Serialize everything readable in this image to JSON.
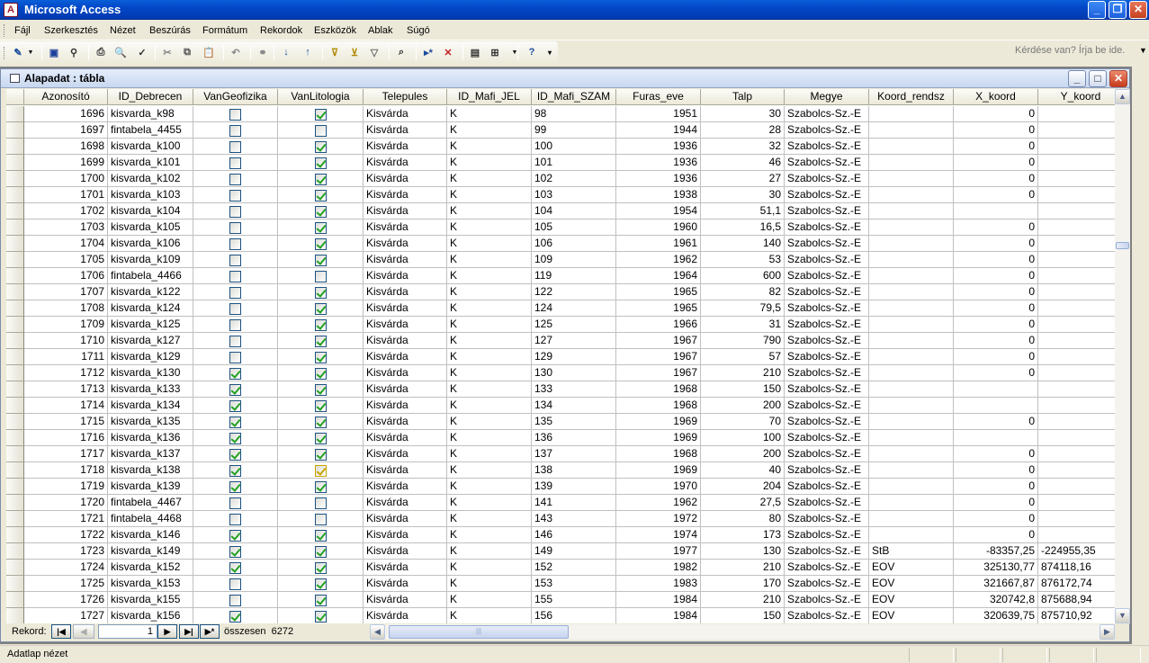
{
  "app": {
    "title": "Microsoft Access"
  },
  "menu": {
    "items": [
      "Fájl",
      "Szerkesztés",
      "Nézet",
      "Beszúrás",
      "Formátum",
      "Rekordok",
      "Eszközök",
      "Ablak",
      "Súgó"
    ],
    "help_placeholder": "Kérdése van? Írja be ide."
  },
  "toolbar": {
    "icons": [
      "view-icon",
      "save-icon",
      "search-icon",
      "print-icon",
      "print-preview-icon",
      "spelling-icon",
      "cut-icon",
      "copy-icon",
      "paste-icon",
      "undo-icon",
      "hyperlink-icon",
      "sort-ascending-icon",
      "sort-descending-icon",
      "filter-by-selection-icon",
      "filter-by-form-icon",
      "apply-filter-icon",
      "find-icon",
      "new-record-icon",
      "delete-record-icon",
      "database-window-icon",
      "new-object-icon",
      "help-icon"
    ]
  },
  "document": {
    "title": "Alapadat : tábla"
  },
  "table": {
    "columns": [
      "Azonosító",
      "ID_Debrecen",
      "VanGeofizika",
      "VanLitologia",
      "Telepules",
      "ID_Mafi_JEL",
      "ID_Mafi_SZAM",
      "Furas_eve",
      "Talp",
      "Megye",
      "Koord_rendsz",
      "X_koord",
      "Y_koord"
    ],
    "rows": [
      {
        "id": "1696",
        "id_debrecen": "kisvarda_k98",
        "geo": false,
        "lito": true,
        "telepules": "Kisvárda",
        "jel": "K",
        "szam": "98",
        "ev": "1951",
        "talp": "30",
        "megye": "Szabolcs-Sz.-E",
        "koord": "",
        "x": "0",
        "y": ""
      },
      {
        "id": "1697",
        "id_debrecen": "fintabela_4455",
        "geo": false,
        "lito": false,
        "telepules": "Kisvárda",
        "jel": "K",
        "szam": "99",
        "ev": "1944",
        "talp": "28",
        "megye": "Szabolcs-Sz.-E",
        "koord": "",
        "x": "0",
        "y": ""
      },
      {
        "id": "1698",
        "id_debrecen": "kisvarda_k100",
        "geo": false,
        "lito": true,
        "telepules": "Kisvárda",
        "jel": "K",
        "szam": "100",
        "ev": "1936",
        "talp": "32",
        "megye": "Szabolcs-Sz.-E",
        "koord": "",
        "x": "0",
        "y": ""
      },
      {
        "id": "1699",
        "id_debrecen": "kisvarda_k101",
        "geo": false,
        "lito": true,
        "telepules": "Kisvárda",
        "jel": "K",
        "szam": "101",
        "ev": "1936",
        "talp": "46",
        "megye": "Szabolcs-Sz.-E",
        "koord": "",
        "x": "0",
        "y": ""
      },
      {
        "id": "1700",
        "id_debrecen": "kisvarda_k102",
        "geo": false,
        "lito": true,
        "telepules": "Kisvárda",
        "jel": "K",
        "szam": "102",
        "ev": "1936",
        "talp": "27",
        "megye": "Szabolcs-Sz.-E",
        "koord": "",
        "x": "0",
        "y": ""
      },
      {
        "id": "1701",
        "id_debrecen": "kisvarda_k103",
        "geo": false,
        "lito": true,
        "telepules": "Kisvárda",
        "jel": "K",
        "szam": "103",
        "ev": "1938",
        "talp": "30",
        "megye": "Szabolcs-Sz.-E",
        "koord": "",
        "x": "0",
        "y": ""
      },
      {
        "id": "1702",
        "id_debrecen": "kisvarda_k104",
        "geo": false,
        "lito": true,
        "telepules": "Kisvárda",
        "jel": "K",
        "szam": "104",
        "ev": "1954",
        "talp": "51,1",
        "megye": "Szabolcs-Sz.-E",
        "koord": "",
        "x": "",
        "y": ""
      },
      {
        "id": "1703",
        "id_debrecen": "kisvarda_k105",
        "geo": false,
        "lito": true,
        "telepules": "Kisvárda",
        "jel": "K",
        "szam": "105",
        "ev": "1960",
        "talp": "16,5",
        "megye": "Szabolcs-Sz.-E",
        "koord": "",
        "x": "0",
        "y": ""
      },
      {
        "id": "1704",
        "id_debrecen": "kisvarda_k106",
        "geo": false,
        "lito": true,
        "telepules": "Kisvárda",
        "jel": "K",
        "szam": "106",
        "ev": "1961",
        "talp": "140",
        "megye": "Szabolcs-Sz.-E",
        "koord": "",
        "x": "0",
        "y": ""
      },
      {
        "id": "1705",
        "id_debrecen": "kisvarda_k109",
        "geo": false,
        "lito": true,
        "telepules": "Kisvárda",
        "jel": "K",
        "szam": "109",
        "ev": "1962",
        "talp": "53",
        "megye": "Szabolcs-Sz.-E",
        "koord": "",
        "x": "0",
        "y": ""
      },
      {
        "id": "1706",
        "id_debrecen": "fintabela_4466",
        "geo": false,
        "lito": false,
        "telepules": "Kisvárda",
        "jel": "K",
        "szam": "119",
        "ev": "1964",
        "talp": "600",
        "megye": "Szabolcs-Sz.-E",
        "koord": "",
        "x": "0",
        "y": ""
      },
      {
        "id": "1707",
        "id_debrecen": "kisvarda_k122",
        "geo": false,
        "lito": true,
        "telepules": "Kisvárda",
        "jel": "K",
        "szam": "122",
        "ev": "1965",
        "talp": "82",
        "megye": "Szabolcs-Sz.-E",
        "koord": "",
        "x": "0",
        "y": ""
      },
      {
        "id": "1708",
        "id_debrecen": "kisvarda_k124",
        "geo": false,
        "lito": true,
        "telepules": "Kisvárda",
        "jel": "K",
        "szam": "124",
        "ev": "1965",
        "talp": "79,5",
        "megye": "Szabolcs-Sz.-E",
        "koord": "",
        "x": "0",
        "y": ""
      },
      {
        "id": "1709",
        "id_debrecen": "kisvarda_k125",
        "geo": false,
        "lito": true,
        "telepules": "Kisvárda",
        "jel": "K",
        "szam": "125",
        "ev": "1966",
        "talp": "31",
        "megye": "Szabolcs-Sz.-E",
        "koord": "",
        "x": "0",
        "y": ""
      },
      {
        "id": "1710",
        "id_debrecen": "kisvarda_k127",
        "geo": false,
        "lito": true,
        "telepules": "Kisvárda",
        "jel": "K",
        "szam": "127",
        "ev": "1967",
        "talp": "790",
        "megye": "Szabolcs-Sz.-E",
        "koord": "",
        "x": "0",
        "y": ""
      },
      {
        "id": "1711",
        "id_debrecen": "kisvarda_k129",
        "geo": false,
        "lito": true,
        "telepules": "Kisvárda",
        "jel": "K",
        "szam": "129",
        "ev": "1967",
        "talp": "57",
        "megye": "Szabolcs-Sz.-E",
        "koord": "",
        "x": "0",
        "y": ""
      },
      {
        "id": "1712",
        "id_debrecen": "kisvarda_k130",
        "geo": true,
        "lito": true,
        "telepules": "Kisvárda",
        "jel": "K",
        "szam": "130",
        "ev": "1967",
        "talp": "210",
        "megye": "Szabolcs-Sz.-E",
        "koord": "",
        "x": "0",
        "y": ""
      },
      {
        "id": "1713",
        "id_debrecen": "kisvarda_k133",
        "geo": true,
        "lito": true,
        "telepules": "Kisvárda",
        "jel": "K",
        "szam": "133",
        "ev": "1968",
        "talp": "150",
        "megye": "Szabolcs-Sz.-E",
        "koord": "",
        "x": "",
        "y": ""
      },
      {
        "id": "1714",
        "id_debrecen": "kisvarda_k134",
        "geo": true,
        "lito": true,
        "telepules": "Kisvárda",
        "jel": "K",
        "szam": "134",
        "ev": "1968",
        "talp": "200",
        "megye": "Szabolcs-Sz.-E",
        "koord": "",
        "x": "",
        "y": ""
      },
      {
        "id": "1715",
        "id_debrecen": "kisvarda_k135",
        "geo": true,
        "lito": true,
        "telepules": "Kisvárda",
        "jel": "K",
        "szam": "135",
        "ev": "1969",
        "talp": "70",
        "megye": "Szabolcs-Sz.-E",
        "koord": "",
        "x": "0",
        "y": ""
      },
      {
        "id": "1716",
        "id_debrecen": "kisvarda_k136",
        "geo": true,
        "lito": true,
        "telepules": "Kisvárda",
        "jel": "K",
        "szam": "136",
        "ev": "1969",
        "talp": "100",
        "megye": "Szabolcs-Sz.-E",
        "koord": "",
        "x": "",
        "y": ""
      },
      {
        "id": "1717",
        "id_debrecen": "kisvarda_k137",
        "geo": true,
        "lito": true,
        "telepules": "Kisvárda",
        "jel": "K",
        "szam": "137",
        "ev": "1968",
        "talp": "200",
        "megye": "Szabolcs-Sz.-E",
        "koord": "",
        "x": "0",
        "y": ""
      },
      {
        "id": "1718",
        "id_debrecen": "kisvarda_k138",
        "geo": true,
        "lito": true,
        "lito_highlight": true,
        "telepules": "Kisvárda",
        "jel": "K",
        "szam": "138",
        "ev": "1969",
        "talp": "40",
        "megye": "Szabolcs-Sz.-E",
        "koord": "",
        "x": "0",
        "y": ""
      },
      {
        "id": "1719",
        "id_debrecen": "kisvarda_k139",
        "geo": true,
        "lito": true,
        "telepules": "Kisvárda",
        "jel": "K",
        "szam": "139",
        "ev": "1970",
        "talp": "204",
        "megye": "Szabolcs-Sz.-E",
        "koord": "",
        "x": "0",
        "y": ""
      },
      {
        "id": "1720",
        "id_debrecen": "fintabela_4467",
        "geo": false,
        "lito": false,
        "telepules": "Kisvárda",
        "jel": "K",
        "szam": "141",
        "ev": "1962",
        "talp": "27,5",
        "megye": "Szabolcs-Sz.-E",
        "koord": "",
        "x": "0",
        "y": ""
      },
      {
        "id": "1721",
        "id_debrecen": "fintabela_4468",
        "geo": false,
        "lito": false,
        "telepules": "Kisvárda",
        "jel": "K",
        "szam": "143",
        "ev": "1972",
        "talp": "80",
        "megye": "Szabolcs-Sz.-E",
        "koord": "",
        "x": "0",
        "y": ""
      },
      {
        "id": "1722",
        "id_debrecen": "kisvarda_k146",
        "geo": true,
        "lito": true,
        "telepules": "Kisvárda",
        "jel": "K",
        "szam": "146",
        "ev": "1974",
        "talp": "173",
        "megye": "Szabolcs-Sz.-E",
        "koord": "",
        "x": "0",
        "y": ""
      },
      {
        "id": "1723",
        "id_debrecen": "kisvarda_k149",
        "geo": true,
        "lito": true,
        "telepules": "Kisvárda",
        "jel": "K",
        "szam": "149",
        "ev": "1977",
        "talp": "130",
        "megye": "Szabolcs-Sz.-E",
        "koord": "StB",
        "x": "-83357,25",
        "y": "-224955,35"
      },
      {
        "id": "1724",
        "id_debrecen": "kisvarda_k152",
        "geo": true,
        "lito": true,
        "telepules": "Kisvárda",
        "jel": "K",
        "szam": "152",
        "ev": "1982",
        "talp": "210",
        "megye": "Szabolcs-Sz.-E",
        "koord": "EOV",
        "x": "325130,77",
        "y": "874118,16"
      },
      {
        "id": "1725",
        "id_debrecen": "kisvarda_k153",
        "geo": false,
        "lito": true,
        "telepules": "Kisvárda",
        "jel": "K",
        "szam": "153",
        "ev": "1983",
        "talp": "170",
        "megye": "Szabolcs-Sz.-E",
        "koord": "EOV",
        "x": "321667,87",
        "y": "876172,74"
      },
      {
        "id": "1726",
        "id_debrecen": "kisvarda_k155",
        "geo": false,
        "lito": true,
        "telepules": "Kisvárda",
        "jel": "K",
        "szam": "155",
        "ev": "1984",
        "talp": "210",
        "megye": "Szabolcs-Sz.-E",
        "koord": "EOV",
        "x": "320742,8",
        "y": "875688,94"
      },
      {
        "id": "1727",
        "id_debrecen": "kisvarda_k156",
        "geo": true,
        "lito": true,
        "telepules": "Kisvárda",
        "jel": "K",
        "szam": "156",
        "ev": "1984",
        "talp": "150",
        "megye": "Szabolcs-Sz.-E",
        "koord": "EOV",
        "x": "320639,75",
        "y": "875710,92"
      }
    ]
  },
  "navigation": {
    "label": "Rekord:",
    "current": "1",
    "total_label": "összesen",
    "total": "6272"
  },
  "status": {
    "text": "Adatlap nézet"
  }
}
